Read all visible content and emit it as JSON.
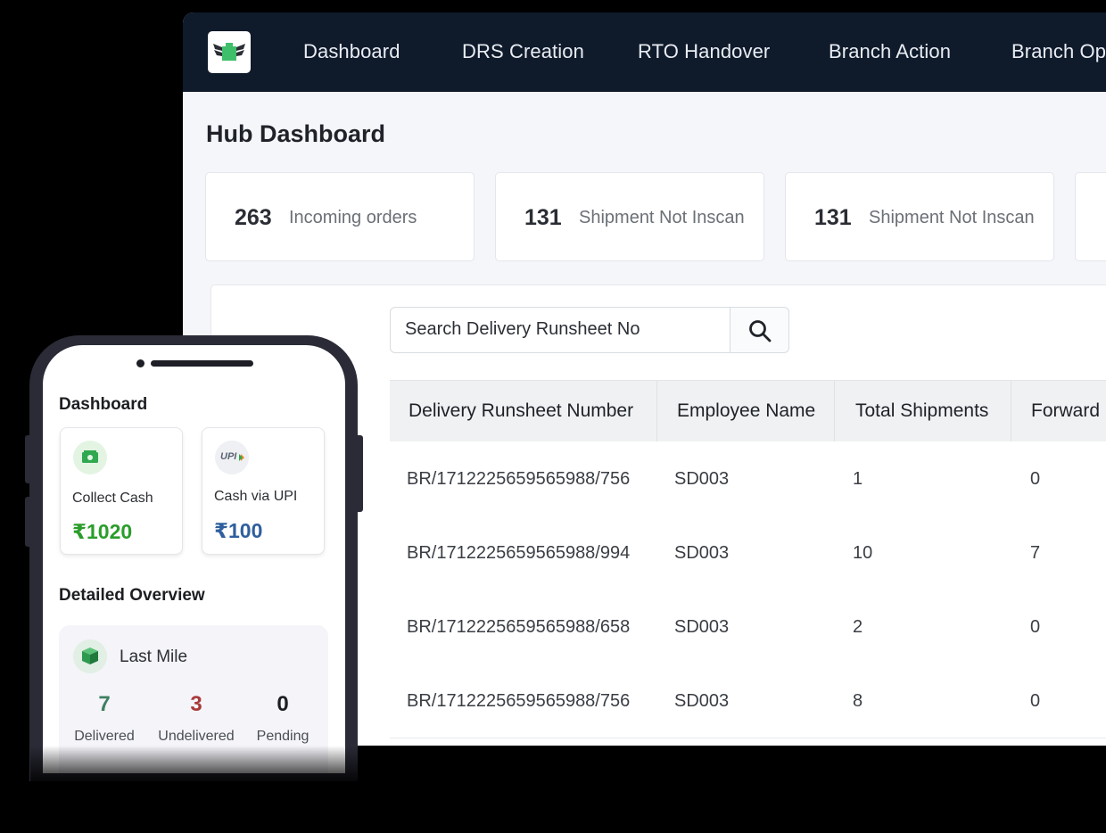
{
  "nav": {
    "logo_icon": "winged-box-logo-icon",
    "items": [
      "Dashboard",
      "DRS Creation",
      "RTO Handover",
      "Branch Action",
      "Branch Op"
    ]
  },
  "page_title": "Hub Dashboard",
  "stats": [
    {
      "value": "263",
      "label": "Incoming orders"
    },
    {
      "value": "131",
      "label": "Shipment Not Inscan"
    },
    {
      "value": "131",
      "label": "Shipment Not Inscan"
    }
  ],
  "search": {
    "placeholder": "Search Delivery Runsheet No",
    "icon": "search-icon"
  },
  "table": {
    "headers": [
      "Delivery Runsheet Number",
      "Employee Name",
      "Total Shipments",
      "Forward"
    ],
    "rows": [
      [
        "BR/1712225659565988/756",
        "SD003",
        "1",
        "0"
      ],
      [
        "BR/1712225659565988/994",
        "SD003",
        "10",
        "7"
      ],
      [
        "BR/1712225659565988/658",
        "SD003",
        "2",
        "0"
      ],
      [
        "BR/1712225659565988/756",
        "SD003",
        "8",
        "0"
      ]
    ]
  },
  "mobile": {
    "dashboard_title": "Dashboard",
    "cards": [
      {
        "label": "Collect Cash",
        "amount": "₹1020",
        "color": "#2a9d2a",
        "icon": "cash-icon"
      },
      {
        "label": "Cash via UPI",
        "amount": "₹100",
        "color": "#2f5f9e",
        "icon": "upi-icon",
        "icon_text": "UPI"
      }
    ],
    "overview_title": "Detailed Overview",
    "overview": {
      "title": "Last Mile",
      "icon": "package-icon",
      "stats": [
        {
          "value": "7",
          "label": "Delivered",
          "color": "#3f7f62"
        },
        {
          "value": "3",
          "label": "Undelivered",
          "color": "#a83a3a"
        },
        {
          "value": "0",
          "label": "Pending",
          "color": "#1c1e22"
        }
      ]
    }
  },
  "colors": {
    "topbar": "#0f1a2b",
    "accent_green": "#2a9d2a",
    "page_bg": "#f5f6fa"
  }
}
